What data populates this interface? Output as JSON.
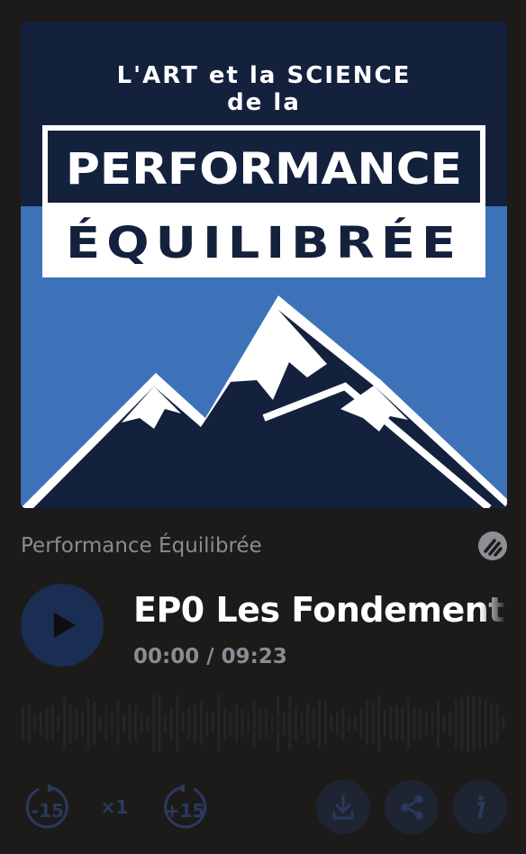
{
  "cover": {
    "line1": "L'ART et la SCIENCE",
    "line2": "de la",
    "line3": "PERFORMANCE",
    "line4": "ÉQUILIBRÉE",
    "colors": {
      "navy": "#14213d",
      "blue": "#3d72b8",
      "white": "#ffffff"
    }
  },
  "player": {
    "show_title": "Performance Équilibrée",
    "brand_icon": "ausha-logo-icon",
    "play_icon": "play-icon",
    "episode_title": "EP0 Les Fondements",
    "current_time": "00:00",
    "separator": " / ",
    "duration": "09:23",
    "progress": 0
  },
  "controls": {
    "rewind_label": "-15",
    "speed_label": "×1",
    "forward_label": "+15",
    "download_icon": "download-icon",
    "share_icon": "share-icon",
    "info_icon": "info-icon"
  },
  "colors": {
    "background": "#1c1b19",
    "accent": "#1a2d52",
    "muted_text": "#8c8a93"
  }
}
